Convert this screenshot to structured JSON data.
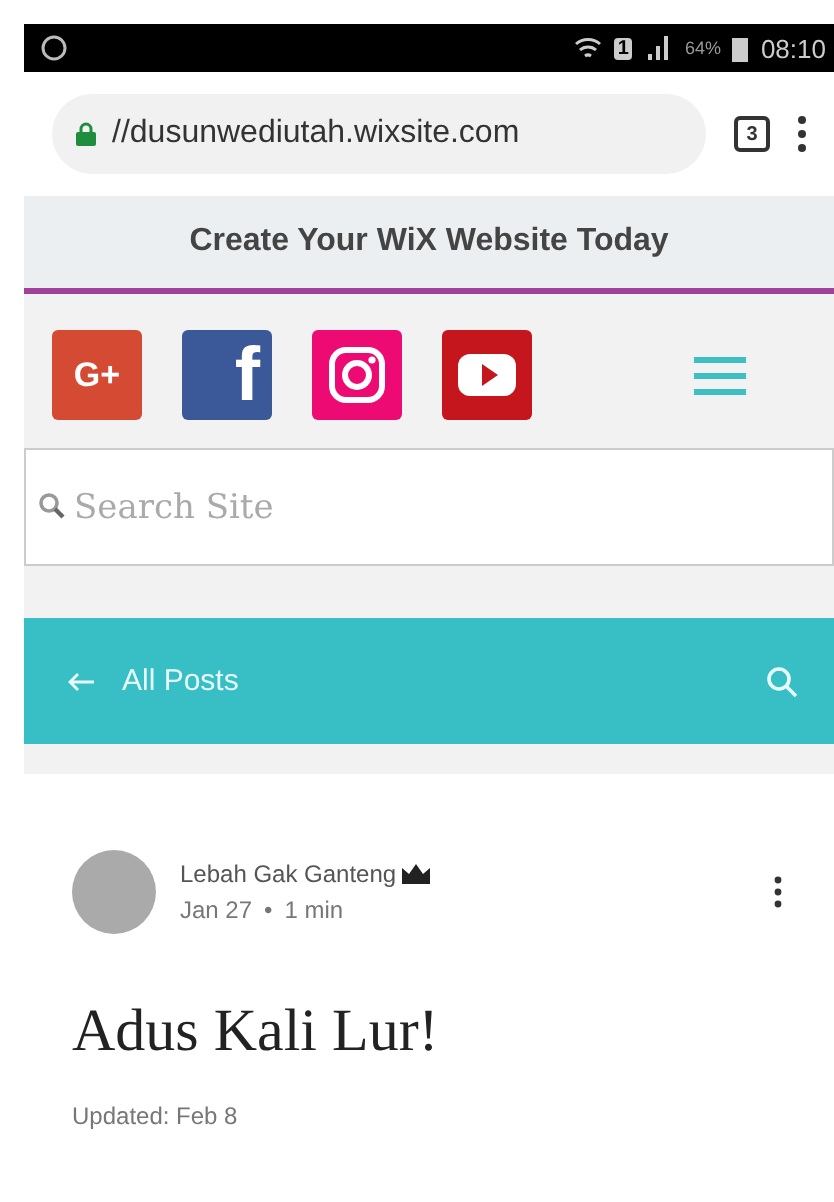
{
  "status_bar": {
    "sim_slot": "1",
    "battery": "64%",
    "time": "08:10"
  },
  "browser": {
    "url": "//dusunwediutah.wixsite.com",
    "tab_count": "3"
  },
  "banner": {
    "text": "Create Your WiX Website Today"
  },
  "social_links": [
    {
      "kind": "googleplus",
      "label": "G+"
    },
    {
      "kind": "facebook",
      "label": "f"
    },
    {
      "kind": "instagram"
    },
    {
      "kind": "youtube"
    }
  ],
  "search": {
    "placeholder": "Search Site"
  },
  "blog_bar": {
    "back_label": "All Posts"
  },
  "post": {
    "author": "Lebah Gak Ganteng",
    "date": "Jan 27",
    "separator": "•",
    "read_time": "1 min",
    "title": "Adus Kali Lur!",
    "updated": "Updated: Feb 8"
  }
}
